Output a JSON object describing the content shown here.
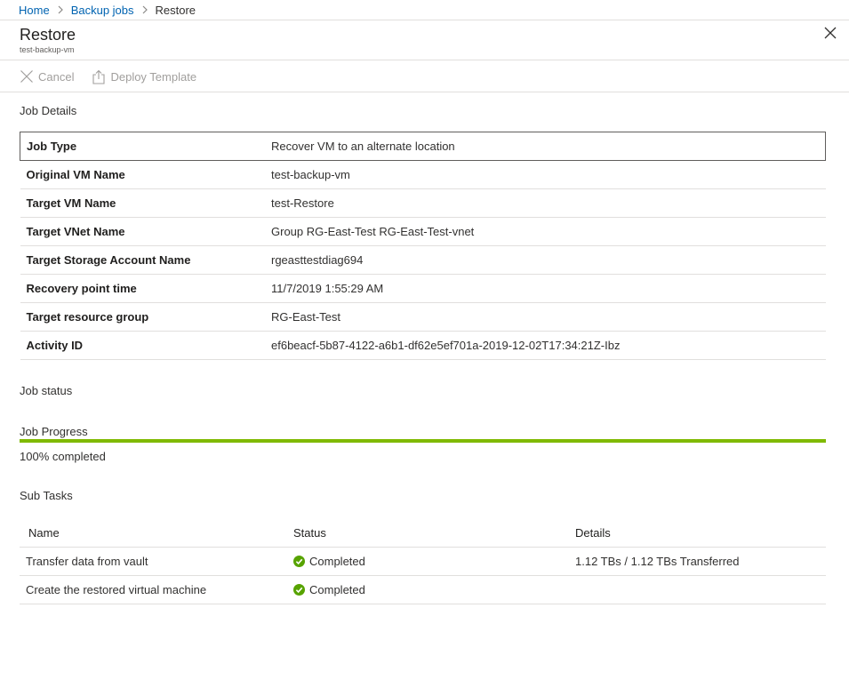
{
  "breadcrumb": {
    "items": [
      {
        "label": "Home"
      },
      {
        "label": "Backup jobs"
      },
      {
        "label": "Restore"
      }
    ]
  },
  "header": {
    "title": "Restore",
    "subtitle": "test-backup-vm"
  },
  "toolbar": {
    "cancel_label": "Cancel",
    "deploy_label": "Deploy Template"
  },
  "job_details": {
    "heading": "Job Details",
    "rows": [
      {
        "key": "Job Type",
        "value": "Recover VM to an alternate location"
      },
      {
        "key": "Original VM Name",
        "value": "test-backup-vm"
      },
      {
        "key": "Target VM Name",
        "value": "test-Restore"
      },
      {
        "key": "Target VNet Name",
        "value": "Group RG-East-Test RG-East-Test-vnet"
      },
      {
        "key": "Target Storage Account Name",
        "value": "rgeasttestdiag694"
      },
      {
        "key": "Recovery point time",
        "value": "11/7/2019 1:55:29 AM"
      },
      {
        "key": "Target resource group",
        "value": "RG-East-Test"
      },
      {
        "key": "Activity ID",
        "value": "ef6beacf-5b87-4122-a6b1-df62e5ef701a-2019-12-02T17:34:21Z-Ibz"
      }
    ]
  },
  "job_status": {
    "heading": "Job status",
    "progress_label": "Job Progress",
    "progress_percent": 100,
    "progress_text": "100% completed",
    "progress_color": "#7fba00"
  },
  "sub_tasks": {
    "heading": "Sub Tasks",
    "columns": [
      "Name",
      "Status",
      "Details"
    ],
    "rows": [
      {
        "name": "Transfer data from vault",
        "status": "Completed",
        "status_icon": "check-circle-icon",
        "details": "1.12 TBs / 1.12 TBs Transferred"
      },
      {
        "name": "Create the restored virtual machine",
        "status": "Completed",
        "status_icon": "check-circle-icon",
        "details": ""
      }
    ]
  }
}
